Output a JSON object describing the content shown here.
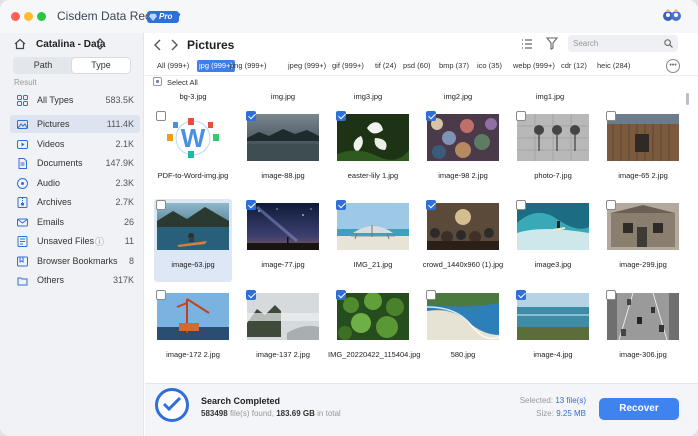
{
  "app": {
    "name": "Cisdem Data Recovery",
    "badge": "Pro",
    "colors": {
      "accent": "#2f6fd9",
      "sidebar": "#f0f2f5",
      "close": "#ff5f57",
      "minimize": "#febc2e",
      "zoom": "#28c840"
    }
  },
  "sidebar": {
    "drive": "Catalina - Data",
    "tabs": [
      "Path",
      "Type"
    ],
    "active_tab": "Type",
    "section": "Result",
    "items": [
      {
        "label": "All Types",
        "count": "583.5K",
        "icon": "grid-icon"
      },
      {
        "label": "Pictures",
        "count": "111.4K",
        "icon": "picture-icon",
        "selected": true
      },
      {
        "label": "Videos",
        "count": "2.1K",
        "icon": "video-icon"
      },
      {
        "label": "Documents",
        "count": "147.9K",
        "icon": "document-icon"
      },
      {
        "label": "Audio",
        "count": "2.3K",
        "icon": "audio-icon"
      },
      {
        "label": "Archives",
        "count": "2.7K",
        "icon": "archive-icon"
      },
      {
        "label": "Emails",
        "count": "26",
        "icon": "email-icon"
      },
      {
        "label": "Unsaved Files",
        "count": "11",
        "icon": "unsaved-icon"
      },
      {
        "label": "Browser Bookmarks",
        "count": "8",
        "icon": "bookmark-icon"
      },
      {
        "label": "Others",
        "count": "317K",
        "icon": "others-icon"
      }
    ]
  },
  "main": {
    "title": "Pictures",
    "search_placeholder": "Search",
    "filters": [
      "All (999+)",
      "jpg (999+)",
      "png (999+)",
      "jpeg (999+)",
      "gif (999+)",
      "tif (24)",
      "psd (60)",
      "bmp (37)",
      "ico (35)",
      "webp (999+)",
      "cdr (12)",
      "heic (284)"
    ],
    "active_filter": "jpg (999+)",
    "select_all": "Select All",
    "partial_row": [
      "bg-3.jpg",
      "img.jpg",
      "img3.jpg",
      "img2.jpg",
      "img1.jpg"
    ],
    "files": [
      {
        "name": "PDF-to-Word-img.jpg",
        "checked": false,
        "thumb": "pdfword"
      },
      {
        "name": "image-88.jpg",
        "checked": true,
        "thumb": "lake"
      },
      {
        "name": "easter-lily 1.jpg",
        "checked": true,
        "thumb": "lily"
      },
      {
        "name": "image-98 2.jpg",
        "checked": true,
        "thumb": "market"
      },
      {
        "name": "photo-7.jpg",
        "checked": false,
        "thumb": "wall"
      },
      {
        "name": "image-65 2.jpg",
        "checked": false,
        "thumb": "shed"
      },
      {
        "name": "image-63.jpg",
        "checked": false,
        "thumb": "kayak",
        "selected": true
      },
      {
        "name": "image-77.jpg",
        "checked": true,
        "thumb": "night"
      },
      {
        "name": "IMG_21.jpg",
        "checked": true,
        "thumb": "beach"
      },
      {
        "name": "crowd_1440x960 (1).jpg",
        "checked": true,
        "thumb": "crowd"
      },
      {
        "name": "image3.jpg",
        "checked": false,
        "thumb": "surf"
      },
      {
        "name": "image-299.jpg",
        "checked": false,
        "thumb": "cabin"
      },
      {
        "name": "image-172 2.jpg",
        "checked": false,
        "thumb": "crane"
      },
      {
        "name": "image-137 2.jpg",
        "checked": true,
        "thumb": "fog"
      },
      {
        "name": "IMG_20220422_115404.jpg",
        "checked": true,
        "thumb": "plant"
      },
      {
        "name": "580.jpg",
        "checked": false,
        "thumb": "coast"
      },
      {
        "name": "image-4.jpg",
        "checked": true,
        "thumb": "sea"
      },
      {
        "name": "image-306.jpg",
        "checked": false,
        "thumb": "road"
      }
    ]
  },
  "footer": {
    "status": "Search Completed",
    "found_count": "583498",
    "found_text": "file(s) found,",
    "found_size": "183.69 GB",
    "found_tail": "in total",
    "selected_label": "Selected:",
    "selected_value": "13 file(s)",
    "size_label": "Size:",
    "size_value": "9.25 MB",
    "recover": "Recover"
  }
}
